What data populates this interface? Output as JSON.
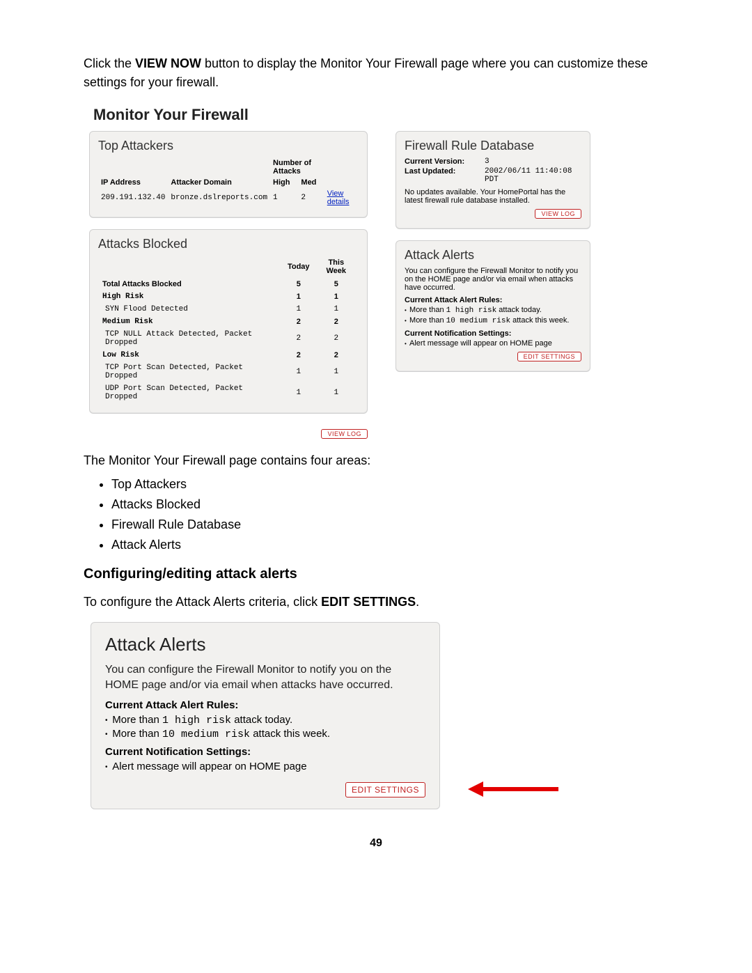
{
  "intro": {
    "pre": "Click the ",
    "btn": "VIEW NOW",
    "post": " button to display the Monitor Your Firewall page where you can customize these settings for your firewall."
  },
  "page_title": "Monitor Your Firewall",
  "top_attackers": {
    "title": "Top Attackers",
    "headers": {
      "ip": "IP Address",
      "domain": "Attacker Domain",
      "group": "Number of Attacks",
      "high": "High",
      "med": "Med"
    },
    "row": {
      "ip": "209.191.132.40",
      "domain": "bronze.dslreports.com",
      "high": "1",
      "med": "2",
      "details": "View details"
    }
  },
  "attacks_blocked": {
    "title": "Attacks Blocked",
    "headers": {
      "today": "Today",
      "week": "This Week"
    },
    "rows": [
      {
        "label": "Total Attacks Blocked",
        "today": "5",
        "week": "5",
        "kind": "total"
      },
      {
        "label": "High Risk",
        "today": "1",
        "week": "1",
        "kind": "cat"
      },
      {
        "label": "SYN Flood Detected",
        "today": "1",
        "week": "1",
        "kind": "sub"
      },
      {
        "label": "Medium Risk",
        "today": "2",
        "week": "2",
        "kind": "cat"
      },
      {
        "label": "TCP NULL Attack Detected, Packet Dropped",
        "today": "2",
        "week": "2",
        "kind": "sub"
      },
      {
        "label": "Low Risk",
        "today": "2",
        "week": "2",
        "kind": "cat"
      },
      {
        "label": "TCP Port Scan Detected, Packet Dropped",
        "today": "1",
        "week": "1",
        "kind": "sub"
      },
      {
        "label": "UDP Port Scan Detected, Packet Dropped",
        "today": "1",
        "week": "1",
        "kind": "sub"
      }
    ],
    "view_log": "VIEW LOG"
  },
  "rule_db": {
    "title": "Firewall Rule Database",
    "version_lbl": "Current Version:",
    "version_val": "3",
    "updated_lbl": "Last Updated:",
    "updated_val": "2002/06/11 11:40:08 PDT",
    "note": "No updates available. Your HomePortal has the latest firewall rule database installed.",
    "view_log": "VIEW LOG"
  },
  "alerts": {
    "title": "Attack Alerts",
    "desc": "You can configure the Firewall Monitor to notify you on the HOME page and/or via email when attacks have occurred.",
    "rules_lbl": "Current Attack Alert Rules:",
    "rule1_pre": "More than ",
    "rule1_code": "1 high risk",
    "rule1_post": " attack today.",
    "rule2_pre": "More than ",
    "rule2_code": "10 medium risk",
    "rule2_post": " attack this week.",
    "notif_lbl": "Current Notification Settings:",
    "notif_item": "Alert message will appear on HOME page",
    "edit": "EDIT SETTINGS"
  },
  "desc_line": "The Monitor Your Firewall page contains four areas:",
  "areas": [
    "Top Attackers",
    "Attacks Blocked",
    "Firewall Rule Database",
    "Attack Alerts"
  ],
  "config_heading": "Configuring/editing attack alerts",
  "config_line_pre": "To configure the Attack Alerts criteria, click ",
  "config_line_bold": "EDIT SETTINGS",
  "config_line_post": ".",
  "aa_large": {
    "title": "Attack Alerts",
    "desc": "You can configure the Firewall Monitor to notify you on the HOME page and/or via email when attacks have occurred.",
    "rules_lbl": "Current Attack Alert Rules:",
    "rule1_pre": "More than ",
    "rule1_code": "1 high risk",
    "rule1_post": " attack today.",
    "rule2_pre": "More than ",
    "rule2_code": "10 medium risk",
    "rule2_post": " attack this week.",
    "notif_lbl": "Current Notification Settings:",
    "notif_item": "Alert message will appear on HOME page",
    "edit": "EDIT SETTINGS"
  },
  "page_number": "49"
}
